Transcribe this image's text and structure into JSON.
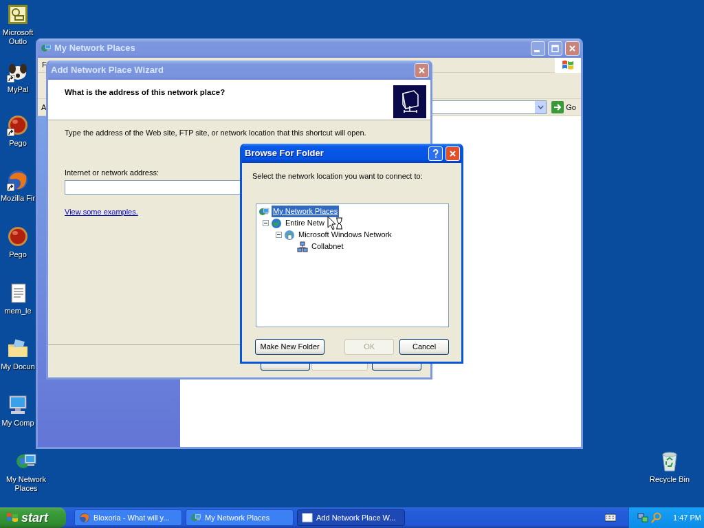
{
  "desktop_icons": [
    {
      "kind": "outlook",
      "label": "Microsoft Outlo",
      "shortcut": false
    },
    {
      "kind": "dog",
      "label": "MyPal",
      "shortcut": true
    },
    {
      "kind": "ball",
      "label": "Pego",
      "shortcut": true
    },
    {
      "kind": "firefox",
      "label": "Mozilla Fir",
      "shortcut": true
    },
    {
      "kind": "ball",
      "label": "Pego",
      "shortcut": false
    },
    {
      "kind": "notepad",
      "label": "mem_le",
      "shortcut": false
    },
    {
      "kind": "documents",
      "label": "My Docun",
      "shortcut": false
    },
    {
      "kind": "computer",
      "label": "My Comp",
      "shortcut": false
    },
    {
      "kind": "network",
      "label": "My Network Places",
      "shortcut": false
    },
    {
      "kind": "recycle",
      "label": "Recycle Bin",
      "shortcut": false
    }
  ],
  "explorer": {
    "title": "My Network Places",
    "active": false,
    "menu_bar": [
      "F"
    ],
    "address_label": "A",
    "go_button": "Go"
  },
  "wizard": {
    "title": "Add Network Place Wizard",
    "active": false,
    "heading": "What is the address of this network place?",
    "description": "Type the address of the Web site, FTP site, or network location that this shortcut will open.",
    "address_label": "Internet or network address:",
    "examples_link": "View some examples.",
    "buttons": [
      {
        "disabled": false
      },
      {
        "disabled": true
      },
      {
        "disabled": false
      }
    ]
  },
  "browse_dialog": {
    "title": "Browse For Folder",
    "active": true,
    "prompt": "Select the network location you want to connect to:",
    "tree": [
      {
        "kind": "network",
        "label": "My Network Places",
        "selected": true,
        "children": [
          {
            "kind": "globe",
            "label": "Entire Netw",
            "selected": false,
            "expanded": true,
            "children": [
              {
                "kind": "windows-network",
                "label": "Microsoft Windows Network",
                "selected": false,
                "expanded": true,
                "children": [
                  {
                    "kind": "workgroup",
                    "label": "Collabnet",
                    "selected": false
                  }
                ]
              }
            ]
          }
        ]
      }
    ],
    "buttons": [
      {
        "label": "Make New Folder",
        "disabled": false
      },
      {
        "label": "OK",
        "disabled": true
      },
      {
        "label": "Cancel",
        "disabled": false
      }
    ]
  },
  "taskbar": {
    "start": "start",
    "tasks": [
      {
        "kind": "firefox",
        "label": "Bloxoria - What will y...",
        "selected": false
      },
      {
        "kind": "network",
        "label": "My Network Places",
        "selected": false
      },
      {
        "kind": "window",
        "label": "Add Network Place W...",
        "selected": true
      }
    ],
    "clock": "1:47 PM"
  }
}
